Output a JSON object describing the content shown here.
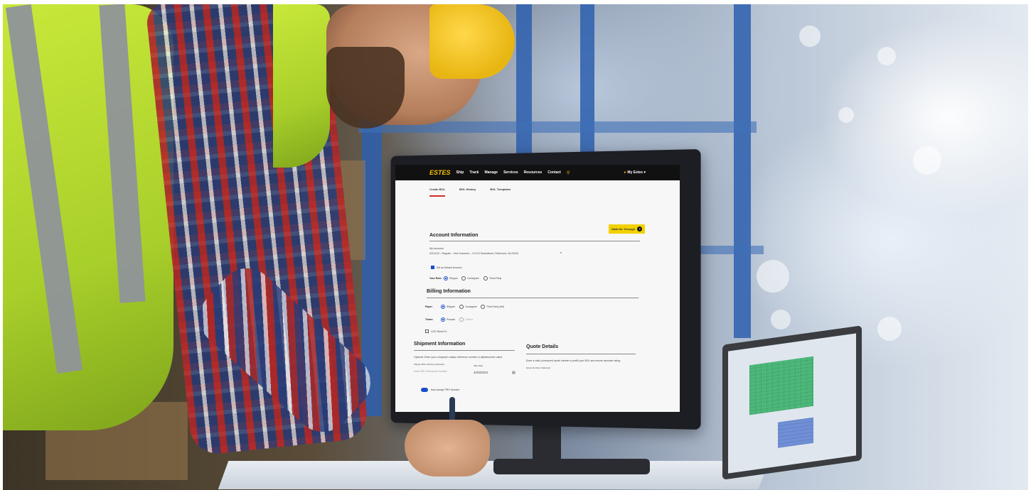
{
  "monitor": {
    "nav": {
      "logo": "ESTES",
      "items": [
        "Ship",
        "Track",
        "Manage",
        "Services",
        "Resources",
        "Contact"
      ],
      "account": "My Estes"
    },
    "tabs": [
      "Create BOL",
      "BOL History",
      "BOL Templates"
    ],
    "walk_button": "Walk Me Through",
    "account_section": {
      "heading": "Account Information",
      "field_label": "My Accounts",
      "field_value": "0212123 – Regular – Test Customer – 1/1710 Somewhere, Richmond, VA 23234",
      "default_checkbox": "Set as Default Account",
      "role_label": "Your Role:",
      "roles": [
        "Shipper",
        "Consignee",
        "Third-Party"
      ]
    },
    "billing_section": {
      "heading": "Billing Information",
      "payer_label": "Payer:",
      "payers": [
        "Shipper",
        "Consignee",
        "Third-Party (bill)"
      ],
      "terms_label": "Terms:",
      "terms": [
        "Prepaid",
        "Collect"
      ],
      "cod_checkbox": "COD Remit To"
    },
    "shipment_section": {
      "heading": "Shipment Information",
      "description": "Optional: Enter your company's unique reference number or alphanumeric value.",
      "ref_label": "Shipper BOL Number (Optional)",
      "ref_placeholder": "Enter BOL Reference Number",
      "date_label": "Ship Date",
      "date_value": "4/23/2024",
      "pro_toggle": "Auto-assign PRO Number"
    },
    "quote_section": {
      "heading": "Quote Details",
      "description": "Enter a valid, preexpired quote number to prefill your BOL and ensure accurate rating.",
      "quote_label": "Quote Number (Optional)"
    }
  },
  "colors": {
    "brand_yellow": "#f2c200",
    "nav_black": "#111111",
    "active_tab": "#d32f2f",
    "radio_blue": "#1a4fc7",
    "vest_green": "#c8e83a",
    "rack_blue": "#2d5fae"
  }
}
